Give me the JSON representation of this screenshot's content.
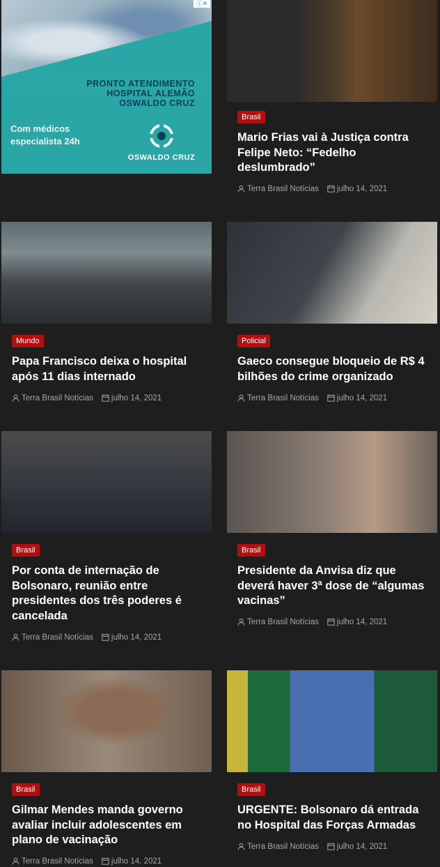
{
  "ad": {
    "pronto": "PRONTO ATENDIMENTO\nHOSPITAL ALEMÃO\nOSWALDO CRUZ",
    "medicos": "Com médicos\nespecialista 24h",
    "logo_text": "OSWALDO CRUZ",
    "adchoice": "ⓘ✕"
  },
  "cards": [
    {
      "category": "Brasil",
      "title": "Mario Frias vai à Justiça contra Felipe Neto: “Fedelho deslumbrado”",
      "author": "Terra Brasil Notícias",
      "date": "julho 14, 2021"
    },
    {
      "category": "Mundo",
      "title": "Papa Francisco deixa o hospital após 11 dias internado",
      "author": "Terra Brasil Notícias",
      "date": "julho 14, 2021"
    },
    {
      "category": "Policial",
      "title": "Gaeco consegue bloqueio de R$ 4 bilhões do crime organizado",
      "author": "Terra Brasil Notícias",
      "date": "julho 14, 2021"
    },
    {
      "category": "Brasil",
      "title": "Por conta de internação de Bolsonaro, reunião entre presidentes dos três poderes é cancelada",
      "author": "Terra Brasil Notícias",
      "date": "julho 14, 2021"
    },
    {
      "category": "Brasil",
      "title": "Presidente da Anvisa diz que deverá haver 3ª dose de “algumas vacinas”",
      "author": "Terra Brasil Notícias",
      "date": "julho 14, 2021"
    },
    {
      "category": "Brasil",
      "title": "Gilmar Mendes manda governo avaliar incluir adolescentes em plano de vacinação",
      "author": "Terra Brasil Notícias",
      "date": "julho 14, 2021"
    },
    {
      "category": "Brasil",
      "title": "URGENTE: Bolsonaro dá entrada no Hospital das Forças Armadas",
      "author": "Terra Brasil Notícias",
      "date": "julho 14, 2021"
    }
  ]
}
